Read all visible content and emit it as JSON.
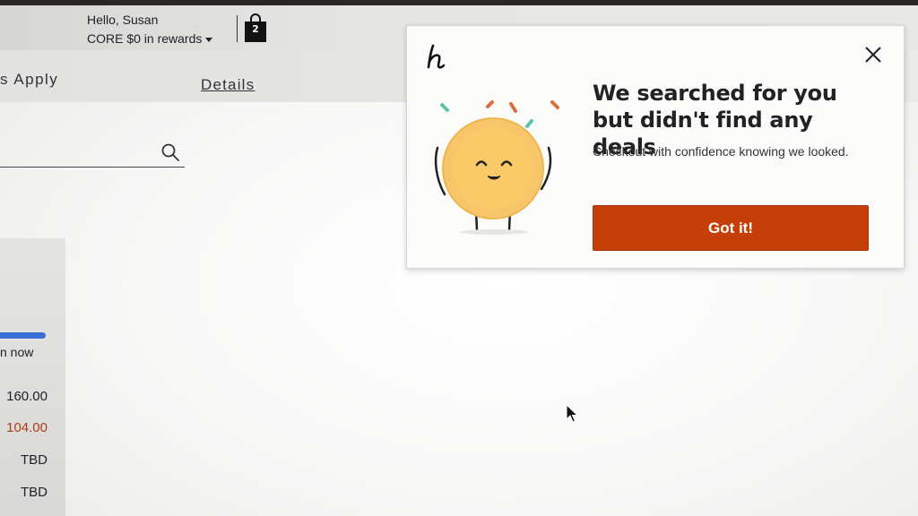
{
  "header": {
    "greeting": "Hello, Susan",
    "rewards": "CORE $0 in rewards",
    "bag_count": "2"
  },
  "subbar": {
    "apply_text": "s Apply",
    "details_link": "Details"
  },
  "summary": {
    "status_text": "n now",
    "line1": "160.00",
    "line2": "104.00",
    "line3": "TBD",
    "line4": "TBD"
  },
  "popup": {
    "title": "We searched for you but didn't find any deals",
    "body": "Checkout with confidence knowing we looked.",
    "button_label": "Got it!"
  },
  "colors": {
    "accent_orange": "#c53f09",
    "progress_blue": "#3a6fd6",
    "coin_yellow": "#f8c56a",
    "discount_red": "#b03a1a"
  },
  "icons": {
    "logo": "honey-h-icon",
    "close": "close-icon",
    "search": "search-icon",
    "bag": "shopping-bag-icon"
  }
}
